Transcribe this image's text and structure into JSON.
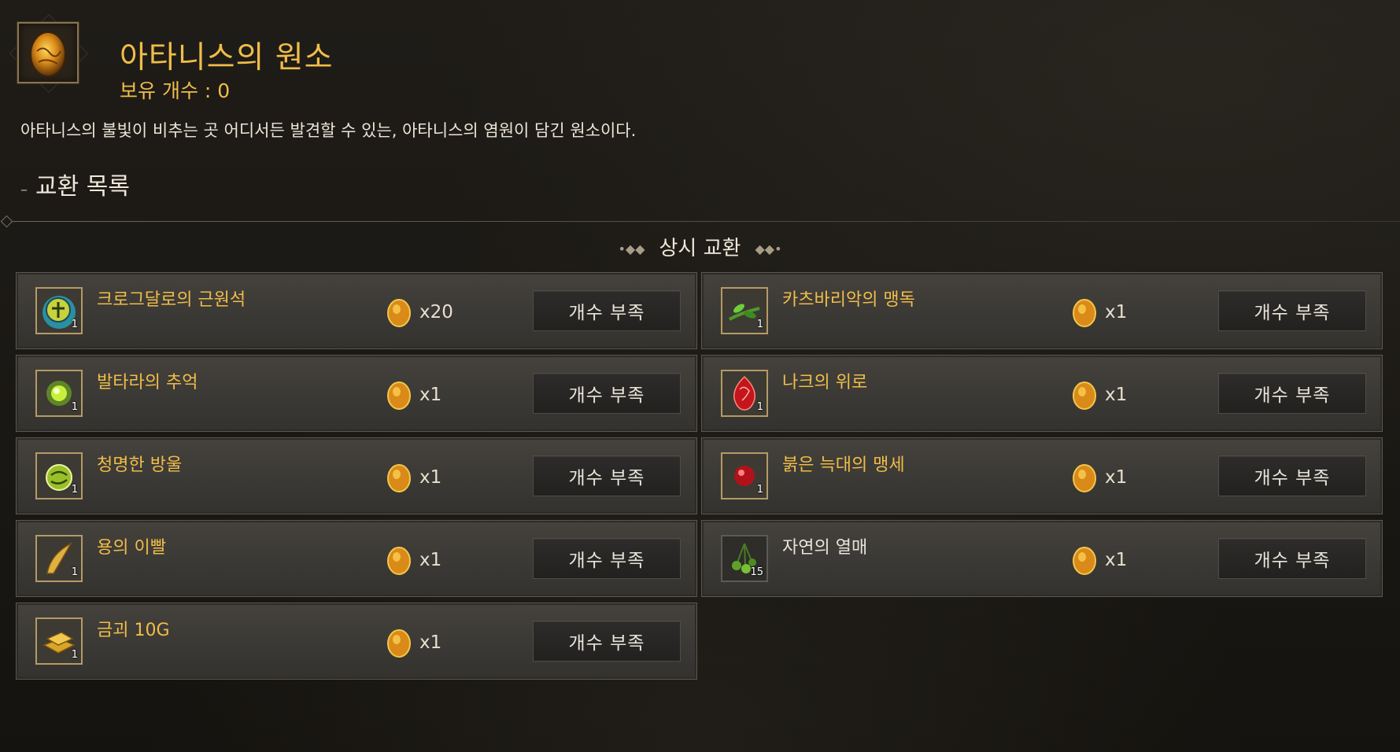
{
  "colors": {
    "accent": "#f0bd48",
    "panel": "#3b3935",
    "button": "#252423"
  },
  "header": {
    "icon": "atanis-element-egg-icon",
    "title": "아타니스의 원소",
    "owned": "보유 개수 : 0",
    "description": "아타니스의 불빛이 비추는 곳 어디서든 발견할 수 있는, 아타니스의 염원이 담긴 원소이다."
  },
  "exchange": {
    "section_title": "교환 목록",
    "sub_title": "상시 교환",
    "items": [
      {
        "name": "크로그달로의 근원석",
        "icon": "crogdalo-stone-icon",
        "qty": "1",
        "cost": "x20",
        "button": "개수 부족"
      },
      {
        "name": "카츠바리악의 맹독",
        "icon": "katsbariak-venom-icon",
        "qty": "1",
        "cost": "x1",
        "button": "개수 부족"
      },
      {
        "name": "발타라의 추억",
        "icon": "baltara-memory-icon",
        "qty": "1",
        "cost": "x1",
        "button": "개수 부족"
      },
      {
        "name": "나크의 위로",
        "icon": "nak-comfort-icon",
        "qty": "1",
        "cost": "x1",
        "button": "개수 부족"
      },
      {
        "name": "청명한 방울",
        "icon": "clear-bell-icon",
        "qty": "1",
        "cost": "x1",
        "button": "개수 부족"
      },
      {
        "name": "붉은 늑대의 맹세",
        "icon": "red-wolf-oath-icon",
        "qty": "1",
        "cost": "x1",
        "button": "개수 부족"
      },
      {
        "name": "용의 이빨",
        "icon": "dragon-tooth-icon",
        "qty": "1",
        "cost": "x1",
        "button": "개수 부족"
      },
      {
        "name": "자연의 열매",
        "icon": "nature-fruit-icon",
        "qty": "15",
        "cost": "x1",
        "button": "개수 부족"
      },
      {
        "name": "금괴 10G",
        "icon": "gold-bar-icon",
        "qty": "1",
        "cost": "x1",
        "button": "개수 부족"
      }
    ]
  }
}
